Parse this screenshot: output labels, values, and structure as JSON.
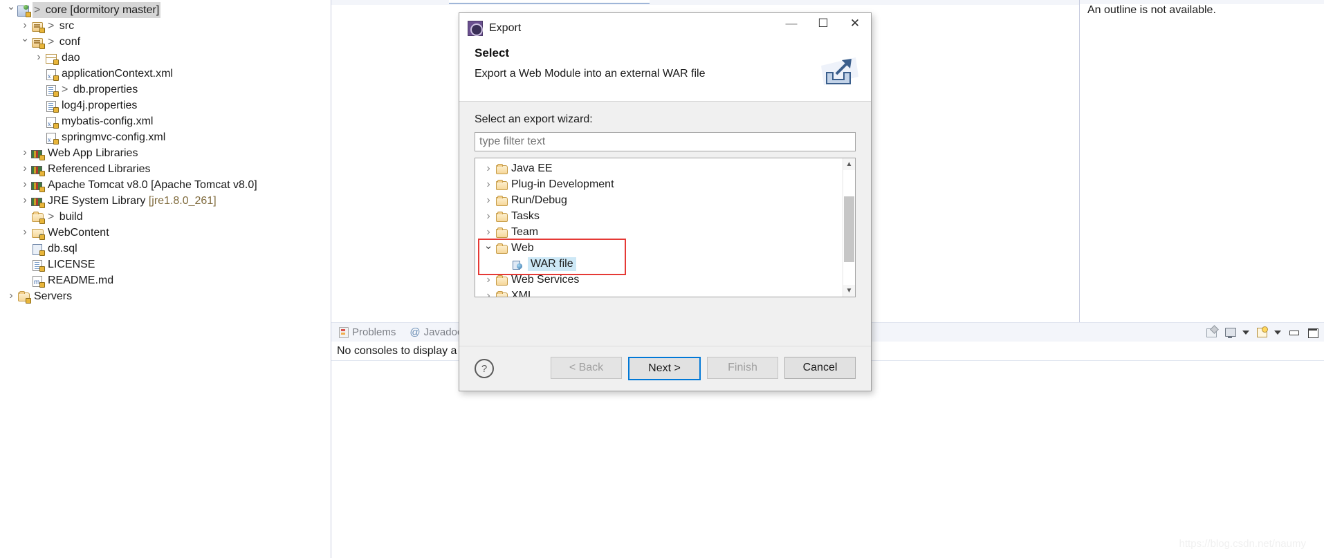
{
  "explorer": {
    "items": [
      {
        "label": "core [dormitory master]",
        "prefix": "> ",
        "indent": 0,
        "twisty": "open",
        "icon": "project-icon",
        "selected": true
      },
      {
        "label": "src",
        "prefix": "> ",
        "indent": 1,
        "twisty": "closed",
        "icon": "source-folder-icon",
        "selected": false
      },
      {
        "label": "conf",
        "prefix": "> ",
        "indent": 1,
        "twisty": "open",
        "icon": "source-folder-icon",
        "selected": false
      },
      {
        "label": "dao",
        "prefix": "",
        "indent": 2,
        "twisty": "closed",
        "icon": "package-icon",
        "selected": false
      },
      {
        "label": "applicationContext.xml",
        "prefix": "",
        "indent": 2,
        "twisty": "none",
        "icon": "xml-file-icon",
        "selected": false
      },
      {
        "label": "db.properties",
        "prefix": "> ",
        "indent": 2,
        "twisty": "none",
        "icon": "properties-file-icon",
        "selected": false
      },
      {
        "label": "log4j.properties",
        "prefix": "",
        "indent": 2,
        "twisty": "none",
        "icon": "properties-file-icon",
        "selected": false
      },
      {
        "label": "mybatis-config.xml",
        "prefix": "",
        "indent": 2,
        "twisty": "none",
        "icon": "xml-file-icon",
        "selected": false
      },
      {
        "label": "springmvc-config.xml",
        "prefix": "",
        "indent": 2,
        "twisty": "none",
        "icon": "xml-file-icon",
        "selected": false
      },
      {
        "label": "Web App Libraries",
        "prefix": "",
        "indent": 1,
        "twisty": "closed",
        "icon": "library-icon",
        "selected": false
      },
      {
        "label": "Referenced Libraries",
        "prefix": "",
        "indent": 1,
        "twisty": "closed",
        "icon": "library-icon",
        "selected": false
      },
      {
        "label": "Apache Tomcat v8.0 [Apache Tomcat v8.0]",
        "prefix": "",
        "indent": 1,
        "twisty": "closed",
        "icon": "library-icon",
        "selected": false
      },
      {
        "label": "JRE System Library ",
        "suffix": "[jre1.8.0_261]",
        "prefix": "",
        "indent": 1,
        "twisty": "closed",
        "icon": "library-icon",
        "selected": false
      },
      {
        "label": "build",
        "prefix": "> ",
        "indent": 1,
        "twisty": "none",
        "icon": "folder-icon",
        "selected": false
      },
      {
        "label": "WebContent",
        "prefix": "",
        "indent": 1,
        "twisty": "closed",
        "icon": "web-content-icon",
        "selected": false
      },
      {
        "label": "db.sql",
        "prefix": "",
        "indent": 1,
        "twisty": "none",
        "icon": "sql-file-icon",
        "selected": false
      },
      {
        "label": "LICENSE",
        "prefix": "",
        "indent": 1,
        "twisty": "none",
        "icon": "text-file-icon",
        "selected": false
      },
      {
        "label": "README.md",
        "prefix": "",
        "indent": 1,
        "twisty": "none",
        "icon": "markdown-file-icon",
        "selected": false
      },
      {
        "label": "Servers",
        "prefix": "",
        "indent": 0,
        "twisty": "closed",
        "icon": "folder-icon",
        "selected": false
      }
    ]
  },
  "outline": {
    "message": "An outline is not available."
  },
  "bottom_panel": {
    "tabs": [
      {
        "label": "Problems",
        "icon": "problems-icon"
      },
      {
        "label": "Javadoc",
        "icon": "at-icon"
      }
    ],
    "console_message": "No consoles to display a",
    "toolbar": [
      {
        "icon": "terminate-icon"
      },
      {
        "icon": "display-selected-console-icon"
      },
      {
        "icon": "chevron-down-icon"
      },
      {
        "icon": "open-console-icon"
      },
      {
        "icon": "chevron-down-icon"
      },
      {
        "icon": "minimize-icon"
      },
      {
        "icon": "maximize-icon"
      }
    ]
  },
  "dialog": {
    "title": "Export",
    "app_icon": "export-wizard-icon",
    "window_buttons": {
      "minimize": "—",
      "maximize": "☐",
      "close": "✕"
    },
    "heading": "Select",
    "subheading": "Export a Web Module into an external WAR file",
    "banner_icon": "export-banner-icon",
    "wizard_label": "Select an export wizard:",
    "filter_placeholder": "type filter text",
    "filter_value": "",
    "tree": [
      {
        "label": "Java EE",
        "indent": 0,
        "twisty": "closed",
        "icon": "folder-icon",
        "selected": false
      },
      {
        "label": "Plug-in Development",
        "indent": 0,
        "twisty": "closed",
        "icon": "folder-icon",
        "selected": false
      },
      {
        "label": "Run/Debug",
        "indent": 0,
        "twisty": "closed",
        "icon": "folder-icon",
        "selected": false
      },
      {
        "label": "Tasks",
        "indent": 0,
        "twisty": "closed",
        "icon": "folder-icon",
        "selected": false
      },
      {
        "label": "Team",
        "indent": 0,
        "twisty": "closed",
        "icon": "folder-icon",
        "selected": false
      },
      {
        "label": "Web",
        "indent": 0,
        "twisty": "open",
        "icon": "folder-icon",
        "selected": false
      },
      {
        "label": "WAR file",
        "indent": 1,
        "twisty": "none",
        "icon": "war-file-icon",
        "selected": true
      },
      {
        "label": "Web Services",
        "indent": 0,
        "twisty": "closed",
        "icon": "folder-icon",
        "selected": false
      },
      {
        "label": "XML",
        "indent": 0,
        "twisty": "closed",
        "icon": "folder-icon",
        "selected": false
      }
    ],
    "highlight_color": "#e53935",
    "selection_color": "#cde8f6",
    "help_icon": "?",
    "buttons": [
      {
        "label": "< Back",
        "state": "disabled"
      },
      {
        "label": "Next >",
        "state": "primary"
      },
      {
        "label": "Finish",
        "state": "disabled"
      },
      {
        "label": "Cancel",
        "state": "plain"
      }
    ]
  },
  "watermark": "https://blog.csdn.net/naumy"
}
